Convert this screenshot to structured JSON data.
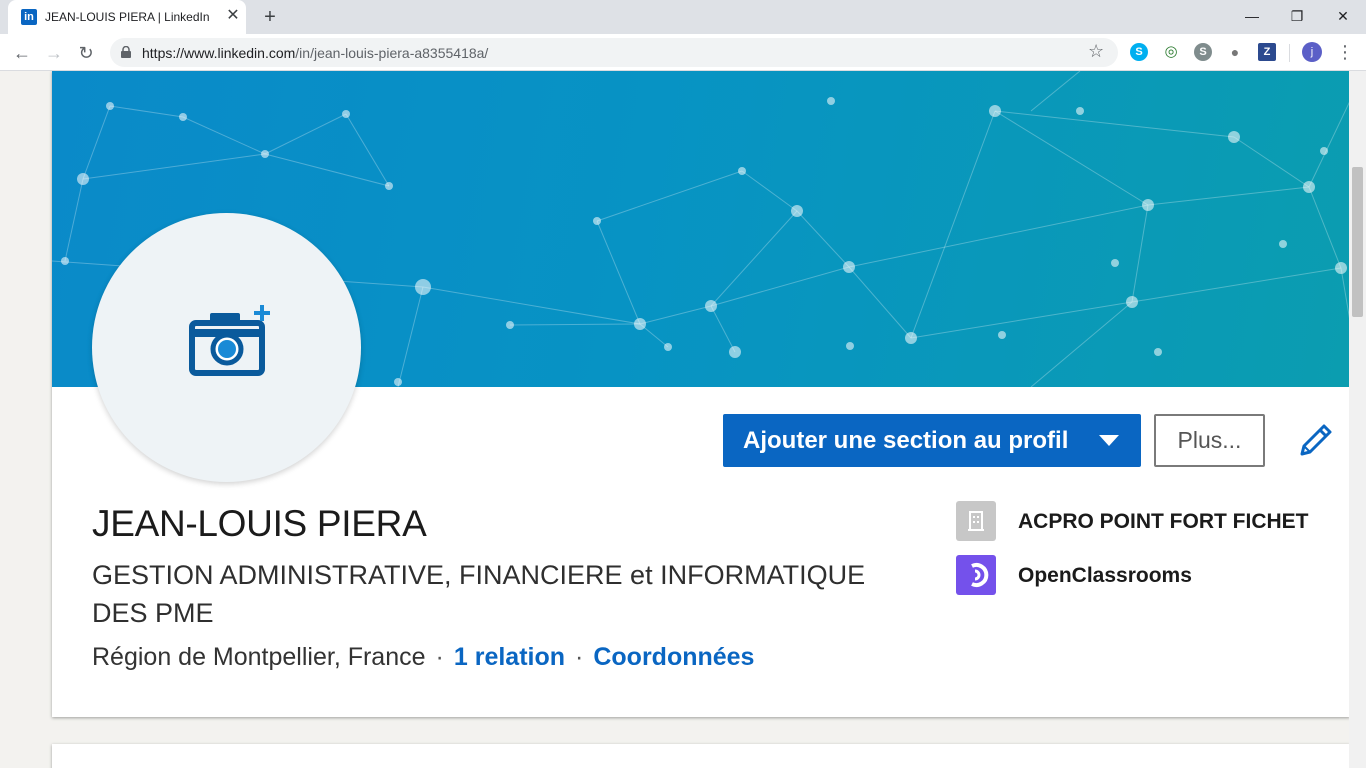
{
  "browser": {
    "tab_title": "JEAN-LOUIS PIERA | LinkedIn",
    "tab_favicon": "in",
    "url_host": "https://www.linkedin.com",
    "url_path": "/in/jean-louis-piera-a8355418a/",
    "profile_initial": "j",
    "extensions": [
      {
        "name": "skype-extension-icon",
        "glyph": "S",
        "color": "#00aff0"
      },
      {
        "name": "green-extension-icon",
        "glyph": "◎",
        "color": "#2e7d32"
      },
      {
        "name": "skype-grey-extension-icon",
        "glyph": "S",
        "color": "#7f8c8d"
      },
      {
        "name": "grey-circle-extension-icon",
        "glyph": "●",
        "color": "#777777"
      },
      {
        "name": "z-extension-icon",
        "glyph": "Z",
        "color": "#2c4a8f"
      }
    ]
  },
  "profile": {
    "name": "JEAN-LOUIS PIERA",
    "headline": "GESTION ADMINISTRATIVE, FINANCIERE et INFORMATIQUE DES PME",
    "location": "Région de Montpellier, France",
    "connections": "1 relation",
    "contact": "Coordonnées",
    "separator": "·"
  },
  "actions": {
    "add_section": "Ajouter une section au profil",
    "more": "Plus..."
  },
  "companies": [
    {
      "name": "ACPRO POINT FORT FICHET",
      "logo_color": "#c7c7c7"
    },
    {
      "name": "OpenClassrooms",
      "logo_color": "#7451eb"
    }
  ],
  "colors": {
    "linkedin_blue": "#0a66c2",
    "banner_start": "#0a8ac9",
    "banner_end": "#0b9db0"
  }
}
